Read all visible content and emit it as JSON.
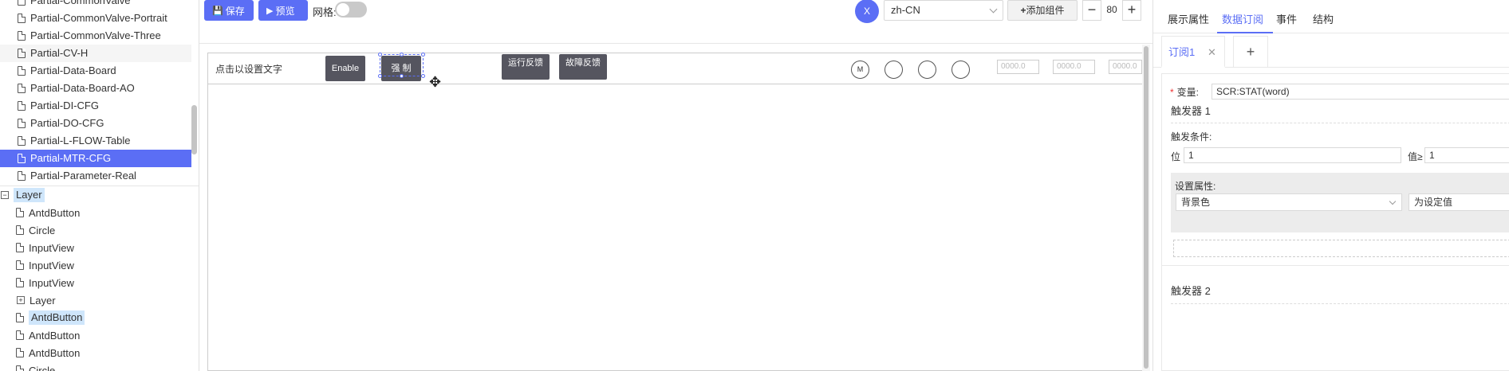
{
  "tree": {
    "top_items": [
      {
        "label": "Partial-CommonValve"
      },
      {
        "label": "Partial-CommonValve-Portrait"
      },
      {
        "label": "Partial-CommonValve-Three"
      },
      {
        "label": "Partial-CV-H"
      },
      {
        "label": "Partial-Data-Board"
      },
      {
        "label": "Partial-Data-Board-AO"
      },
      {
        "label": "Partial-DI-CFG"
      },
      {
        "label": "Partial-DO-CFG"
      },
      {
        "label": "Partial-L-FLOW-Table"
      },
      {
        "label": "Partial-MTR-CFG"
      },
      {
        "label": "Partial-Parameter-Real"
      }
    ],
    "layer_root": {
      "label": "Layer",
      "toggle": "−"
    },
    "layer_children": [
      {
        "label": "AntdButton"
      },
      {
        "label": "Circle"
      },
      {
        "label": "InputView"
      },
      {
        "label": "InputView"
      },
      {
        "label": "InputView"
      },
      {
        "label": "Layer",
        "toggle": "+"
      },
      {
        "label": "AntdButton"
      },
      {
        "label": "AntdButton"
      },
      {
        "label": "AntdButton"
      },
      {
        "label": "Circle"
      }
    ]
  },
  "toolbar": {
    "save_icon": "save-icon",
    "save_label": "保存",
    "preview_icon": "play-icon",
    "preview_label": "预览",
    "grid_label": "网格:",
    "avatar_text": "X",
    "language": "zh-CN",
    "add_component_label": "添加组件",
    "zoom_minus": "−",
    "zoom_value": "80",
    "zoom_plus": "+"
  },
  "canvas": {
    "set_text": "点击以设置文字",
    "enable_label": "Enable",
    "force_label": "强 制",
    "run_feedback_label": "运行反馈",
    "fault_feedback_label": "故障反馈",
    "motor_label": "M",
    "input_values": [
      "0000.0",
      "0000.0",
      "0000.0"
    ]
  },
  "right_panel": {
    "tabs": [
      "展示属性",
      "数据订阅",
      "事件",
      "结构"
    ],
    "active_tab": "数据订阅",
    "subscription_tab": "订阅1",
    "variable_label": "变量:",
    "variable_value": "SCR:STAT(word)",
    "trigger1_title": "触发器 1",
    "condition_label": "触发条件:",
    "bit_label": "位",
    "bit_value": "1",
    "value_label": "值≥",
    "value_value": "1",
    "set_property_label": "设置属性:",
    "property_select": "背景色",
    "set_value_label": "为设定值",
    "trigger2_title": "触发器 2"
  },
  "colors": {
    "accent": "#5b6ef5",
    "dark_button": "#55555f",
    "selected_tree_bg": "#5b6ef5",
    "highlight_tree_bg": "#cfe6fb"
  }
}
